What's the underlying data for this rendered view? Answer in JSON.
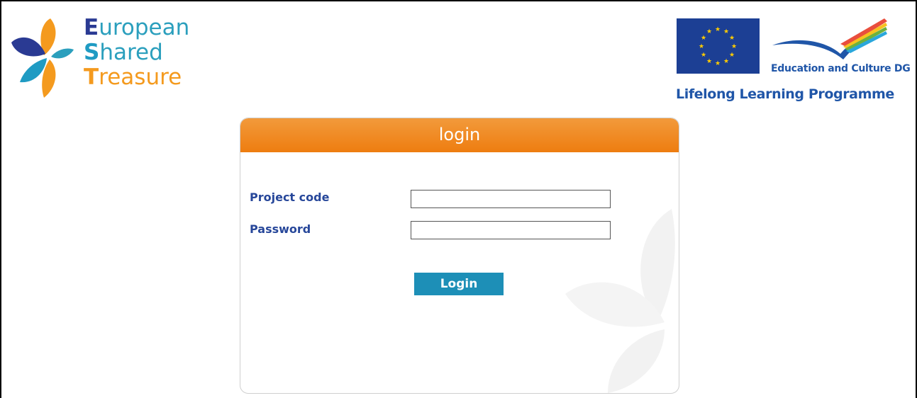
{
  "brand": {
    "line1": {
      "cap": "E",
      "rest": "uropean"
    },
    "line2": {
      "cap": "S",
      "rest": "hared"
    },
    "line3": {
      "cap": "T",
      "rest": "reasure"
    }
  },
  "eu_logo": {
    "dg_label": "Education and Culture DG",
    "programme": "Lifelong Learning Programme"
  },
  "login": {
    "title": "login",
    "project_code_label": "Project code",
    "project_code_value": "",
    "password_label": "Password",
    "password_value": "",
    "button_label": "Login"
  },
  "colors": {
    "header_orange": "#ee7d10",
    "button_blue": "#1d8fb7",
    "label_blue": "#27479a",
    "eu_blue": "#1c3f94",
    "eu_star": "#ffcc00"
  }
}
